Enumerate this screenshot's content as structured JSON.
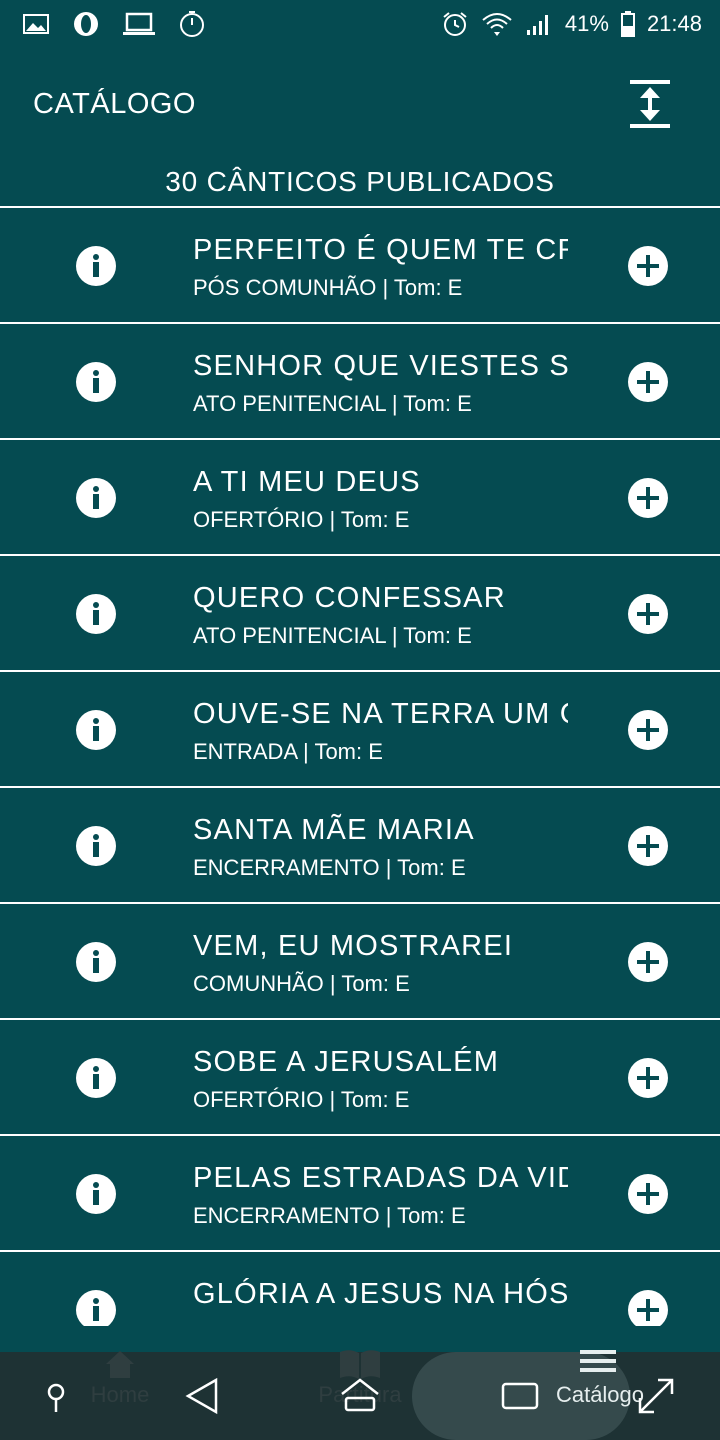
{
  "status_bar": {
    "battery": "41%",
    "time": "21:48",
    "left_icons": [
      "image-icon",
      "opera-icon",
      "laptop-icon",
      "timer-icon"
    ],
    "right_icons": [
      "alarm-icon",
      "wifi-icon",
      "signal-icon",
      "battery-icon"
    ]
  },
  "header": {
    "title": "CATÁLOGO",
    "action_icon": "expand-vertical-icon"
  },
  "summary": {
    "count_text": "30 CÂNTICOS PUBLICADOS"
  },
  "songs": [
    {
      "title": "PERFEITO É QUEM TE CR",
      "subtitle": "PÓS COMUNHÃO | Tom: E"
    },
    {
      "title": "SENHOR QUE VIESTES SA",
      "subtitle": "ATO PENITENCIAL | Tom: E"
    },
    {
      "title": "A TI MEU DEUS",
      "subtitle": "OFERTÓRIO | Tom: E"
    },
    {
      "title": "QUERO CONFESSAR",
      "subtitle": "ATO PENITENCIAL | Tom: E"
    },
    {
      "title": "OUVE-SE NA TERRA UM C",
      "subtitle": "ENTRADA | Tom: E"
    },
    {
      "title": "SANTA MÃE MARIA",
      "subtitle": "ENCERRAMENTO | Tom: E"
    },
    {
      "title": "VEM, EU MOSTRAREI",
      "subtitle": "COMUNHÃO | Tom: E"
    },
    {
      "title": "SOBE A JERUSALÉM",
      "subtitle": "OFERTÓRIO | Tom: E"
    },
    {
      "title": "PELAS ESTRADAS DA VID",
      "subtitle": "ENCERRAMENTO | Tom: E"
    },
    {
      "title": "GLÓRIA A JESUS NA HÓS",
      "subtitle": ""
    }
  ],
  "tabs": {
    "home": "Home",
    "partitura": "Partitura",
    "catalogo": "Catálogo"
  },
  "colors": {
    "background": "#054b51",
    "foreground": "#ffffff",
    "bottom_bar": "#1e3234"
  }
}
